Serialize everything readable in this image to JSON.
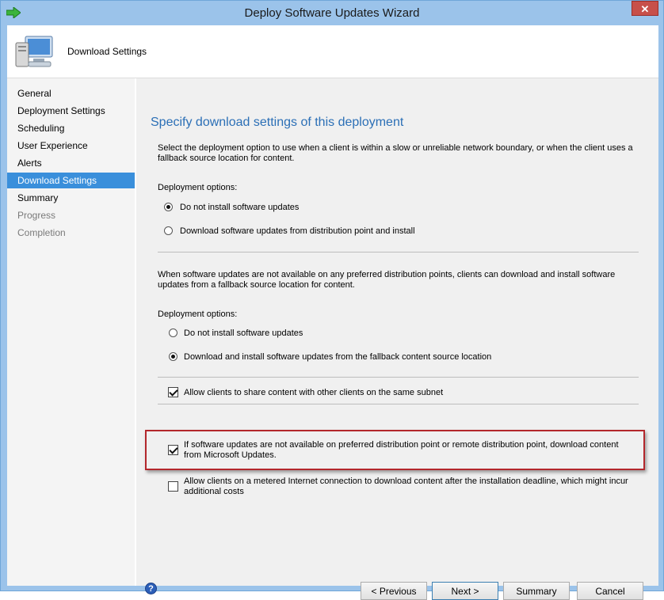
{
  "window": {
    "title": "Deploy Software Updates Wizard",
    "close_glyph": "✕"
  },
  "header": {
    "page_name": "Download Settings",
    "icon": "computer-monitor-icon"
  },
  "sidebar": {
    "items": [
      {
        "label": "General",
        "state": "normal"
      },
      {
        "label": "Deployment Settings",
        "state": "normal"
      },
      {
        "label": "Scheduling",
        "state": "normal"
      },
      {
        "label": "User Experience",
        "state": "normal"
      },
      {
        "label": "Alerts",
        "state": "normal"
      },
      {
        "label": "Download Settings",
        "state": "active"
      },
      {
        "label": "Summary",
        "state": "normal"
      },
      {
        "label": "Progress",
        "state": "disabled"
      },
      {
        "label": "Completion",
        "state": "disabled"
      }
    ]
  },
  "main": {
    "heading": "Specify download settings of this deployment",
    "section1": {
      "description": "Select the deployment option to use when a client is within a slow or unreliable network boundary, or when the client uses a fallback source location for content.",
      "options_label": "Deployment options:",
      "options": [
        {
          "label": "Do not install software updates",
          "selected": true
        },
        {
          "label": "Download software updates from distribution point and install",
          "selected": false
        }
      ]
    },
    "section2": {
      "description": "When software updates are not available on any preferred distribution points, clients can download and install software updates from a fallback source location for content.",
      "options_label": "Deployment options:",
      "options": [
        {
          "label": "Do not install software updates",
          "selected": false
        },
        {
          "label": "Download and install software updates from the fallback content source location",
          "selected": true
        }
      ]
    },
    "checkboxes": [
      {
        "label": "Allow clients to share content with other clients on the same subnet",
        "checked": true
      },
      {
        "label": "If software updates are not available on preferred distribution point or remote distribution point, download content from Microsoft Updates.",
        "checked": true
      },
      {
        "label": "Allow clients on a metered Internet connection to download content after the installation deadline, which might incur additional costs",
        "checked": false
      }
    ]
  },
  "footer": {
    "help_glyph": "?",
    "buttons": {
      "previous": "< Previous",
      "next": "Next >",
      "summary": "Summary",
      "cancel": "Cancel"
    }
  },
  "colors": {
    "accent": "#3a8fdb",
    "heading": "#2b6fb6",
    "highlight": "#b3272c",
    "titlebar": "#9bc3ea"
  }
}
